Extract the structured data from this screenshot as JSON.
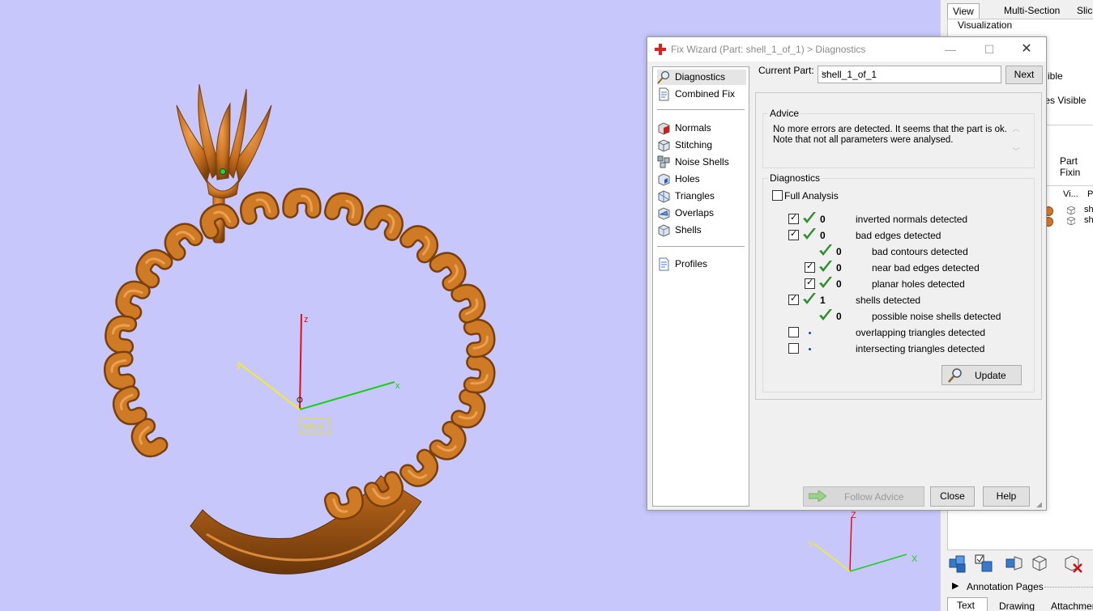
{
  "right_panel": {
    "tabs": [
      "View",
      "Multi-Section",
      "Slice"
    ],
    "group_label": "Visualization",
    "visible_1": "ible",
    "visible_2": "iles Visible",
    "part_fixing_tab": "Part Fixin",
    "col_headers": [
      "Vi...",
      "Pa"
    ],
    "rows": [
      "sh",
      "sh"
    ],
    "annotation_label": "Annotation Pages",
    "bottom_tabs": [
      "Text",
      "Drawing",
      "Attachmen"
    ]
  },
  "viewport": {
    "wcs_label": "WCS",
    "axes": {
      "x": "x",
      "y": "y",
      "z": "z"
    },
    "mini_axes": {
      "x": "X",
      "y": "Y",
      "z": "Z"
    }
  },
  "dialog": {
    "title": "Fix Wizard (Part: shell_1_of_1) > Diagnostics",
    "nav_top": [
      {
        "label": "Diagnostics",
        "icon": "magnifier-icon",
        "selected": true
      },
      {
        "label": "Combined Fix",
        "icon": "page-icon",
        "selected": false
      }
    ],
    "nav_mid": [
      {
        "label": "Normals",
        "icon": "normals-cube-icon"
      },
      {
        "label": "Stitching",
        "icon": "stitching-cube-icon"
      },
      {
        "label": "Noise Shells",
        "icon": "noise-shells-icon"
      },
      {
        "label": "Holes",
        "icon": "holes-cube-icon"
      },
      {
        "label": "Triangles",
        "icon": "triangles-cube-icon"
      },
      {
        "label": "Overlaps",
        "icon": "overlaps-cube-icon"
      },
      {
        "label": "Shells",
        "icon": "shells-cube-icon"
      }
    ],
    "nav_bottom": [
      {
        "label": "Profiles",
        "icon": "profiles-doc-icon"
      }
    ],
    "current_part_label": "Current Part:",
    "current_part_value": "shell_1_of_1",
    "next_label": "Next",
    "advice_title": "Advice",
    "advice_line1": "No more errors are detected. It seems that the part is ok.",
    "advice_line2": "Note that not all parameters were analysed.",
    "diagnostics_title": "Diagnostics",
    "full_analysis_label": "Full Analysis",
    "full_analysis_checked": false,
    "items": [
      {
        "checkbox": true,
        "checked": true,
        "status": "ok",
        "count": "0",
        "label": "inverted normals detected",
        "indent": 0
      },
      {
        "checkbox": true,
        "checked": true,
        "status": "ok",
        "count": "0",
        "label": "bad edges detected",
        "indent": 0
      },
      {
        "checkbox": false,
        "checked": false,
        "status": "ok",
        "count": "0",
        "label": "bad contours detected",
        "indent": 1
      },
      {
        "checkbox": true,
        "checked": true,
        "status": "ok",
        "count": "0",
        "label": "near bad edges detected",
        "indent": 1
      },
      {
        "checkbox": true,
        "checked": true,
        "status": "ok",
        "count": "0",
        "label": "planar holes detected",
        "indent": 1
      },
      {
        "checkbox": true,
        "checked": true,
        "status": "ok",
        "count": "1",
        "label": "shells detected",
        "indent": 0
      },
      {
        "checkbox": false,
        "checked": false,
        "status": "ok",
        "count": "0",
        "label": "possible noise shells detected",
        "indent": 1
      },
      {
        "checkbox": true,
        "checked": false,
        "status": "pending",
        "count": "",
        "label": "overlapping triangles detected",
        "indent": 0
      },
      {
        "checkbox": true,
        "checked": false,
        "status": "pending",
        "count": "",
        "label": "intersecting triangles detected",
        "indent": 0
      }
    ],
    "update_label": "Update",
    "follow_advice_label": "Follow Advice",
    "close_label": "Close",
    "help_label": "Help"
  },
  "colors": {
    "viewport_bg": "#c7c7fb",
    "model_orange": "#c8711f",
    "check_green": "#2f8f2f"
  }
}
